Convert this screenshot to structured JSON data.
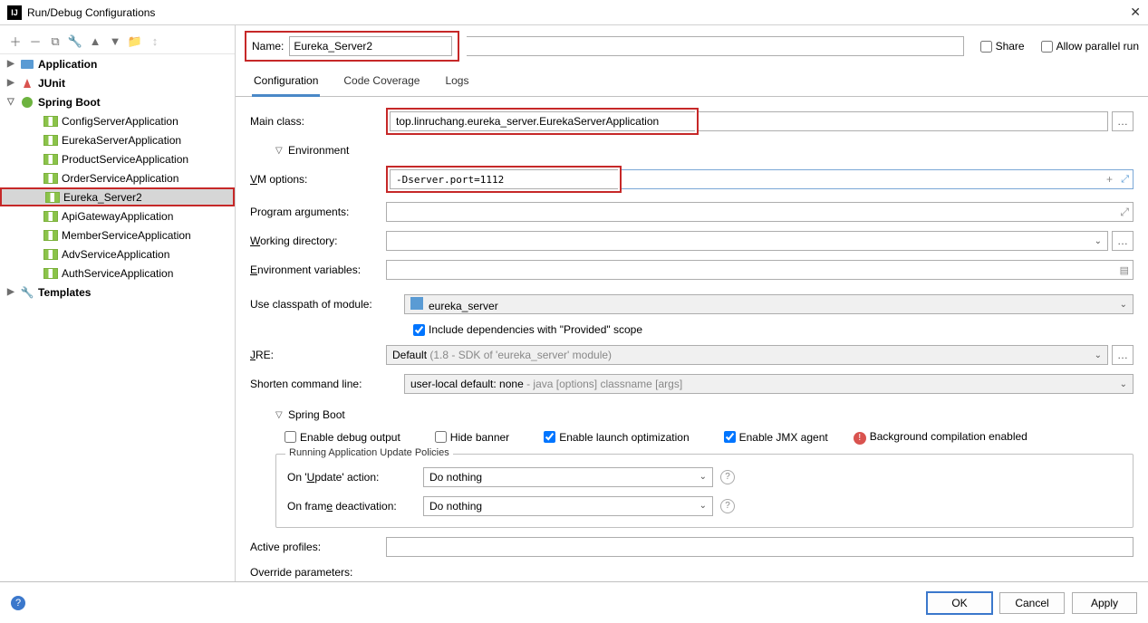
{
  "window": {
    "title": "Run/Debug Configurations"
  },
  "tree": {
    "app": "Application",
    "junit": "JUnit",
    "spring": "Spring Boot",
    "templates": "Templates",
    "springItems": [
      "ConfigServerApplication",
      "EurekaServerApplication",
      "ProductServiceApplication",
      "OrderServiceApplication",
      "Eureka_Server2",
      "ApiGatewayApplication",
      "MemberServiceApplication",
      "AdvServiceApplication",
      "AuthServiceApplication"
    ]
  },
  "top": {
    "nameLabel": "Name:",
    "nameValue": "Eureka_Server2",
    "share": "Share",
    "allowParallel": "Allow parallel run"
  },
  "tabs": {
    "config": "Configuration",
    "coverage": "Code Coverage",
    "logs": "Logs"
  },
  "form": {
    "mainClassLabel": "Main class:",
    "mainClassValue": "top.linruchang.eureka_server.EurekaServerApplication",
    "envHeader": "Environment",
    "vmLabel": "VM options:",
    "vmValue": "-Dserver.port=1112",
    "programArgsLabel": "Program arguments:",
    "workingDirLabel": "Working directory:",
    "envVarsLabel": "Environment variables:",
    "classpathLabel": "Use classpath of module:",
    "classpathValue": "eureka_server",
    "includeProvided": "Include dependencies with \"Provided\" scope",
    "jreLabel": "JRE:",
    "jreValue": "Default",
    "jreHint": " (1.8 - SDK of 'eureka_server' module)",
    "shortenLabel": "Shorten command line:",
    "shortenValue": "user-local default: none",
    "shortenHint": " - java [options] classname [args]",
    "springHeader": "Spring Boot",
    "enableDebug": "Enable debug output",
    "hideBanner": "Hide banner",
    "enableLaunchOpt": "Enable launch optimization",
    "enableJmx": "Enable JMX agent",
    "bgCompile": "Background compilation enabled",
    "updatePolicies": "Running Application Update Policies",
    "onUpdateLabel": "On 'Update' action:",
    "onFrameLabel": "On frame deactivation:",
    "doNothing": "Do nothing",
    "activeProfilesLabel": "Active profiles:",
    "overrideParamsLabel": "Override parameters:"
  },
  "footer": {
    "ok": "OK",
    "cancel": "Cancel",
    "apply": "Apply"
  }
}
